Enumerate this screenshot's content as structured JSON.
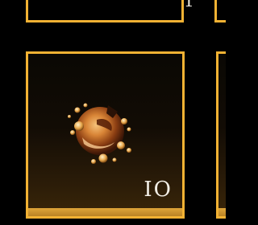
{
  "inventory": {
    "top_slot": {
      "count_label": "1"
    },
    "selected_slot": {
      "item_icon": "amber-orb-icon",
      "count_label": "10",
      "count_display": "IO"
    }
  },
  "colors": {
    "slot_border": "#f2b233",
    "count_text": "#f3efe6",
    "background": "#000000"
  }
}
